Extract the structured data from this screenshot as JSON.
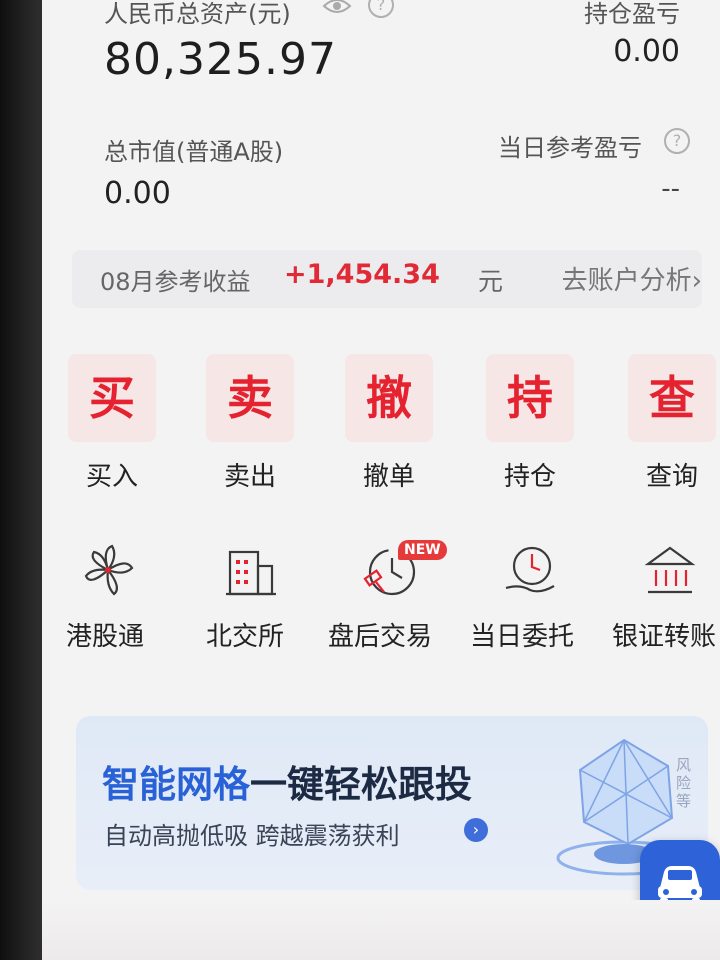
{
  "summary": {
    "total_assets_label": "人民币总资产(元)",
    "total_assets_value": "80,325.97",
    "holding_pnl_label": "持仓盈亏",
    "holding_pnl_value": "0.00",
    "market_value_label": "总市值(普通A股)",
    "market_value_value": "0.00",
    "daily_pnl_label": "当日参考盈亏",
    "daily_pnl_value": "--",
    "help_glyph": "?"
  },
  "monthly": {
    "label": "08月参考收益",
    "amount": "+1,454.34",
    "unit": "元",
    "link": "去账户分析",
    "link_chevron": "›"
  },
  "trade_actions": [
    {
      "glyph": "买",
      "label": "买入"
    },
    {
      "glyph": "卖",
      "label": "卖出"
    },
    {
      "glyph": "撤",
      "label": "撤单"
    },
    {
      "glyph": "持",
      "label": "持仓"
    },
    {
      "glyph": "查",
      "label": "查询"
    }
  ],
  "services": [
    {
      "label": "港股通",
      "icon": "bauhinia-icon"
    },
    {
      "label": "北交所",
      "icon": "building-icon"
    },
    {
      "label": "盘后交易",
      "icon": "gavel-clock-icon"
    },
    {
      "label": "当日委托",
      "icon": "hand-clock-icon"
    },
    {
      "label": "银证转账",
      "icon": "bank-icon"
    }
  ],
  "new_badge": "NEW",
  "promo": {
    "title_highlight": "智能网格",
    "title_rest": "一键轻松跟投",
    "subtitle": "自动高抛低吸 跨越震荡获利",
    "arrow": "›",
    "side_tag": "风险等"
  },
  "colors": {
    "accent_red": "#e52330",
    "brand_blue": "#2961d6"
  }
}
